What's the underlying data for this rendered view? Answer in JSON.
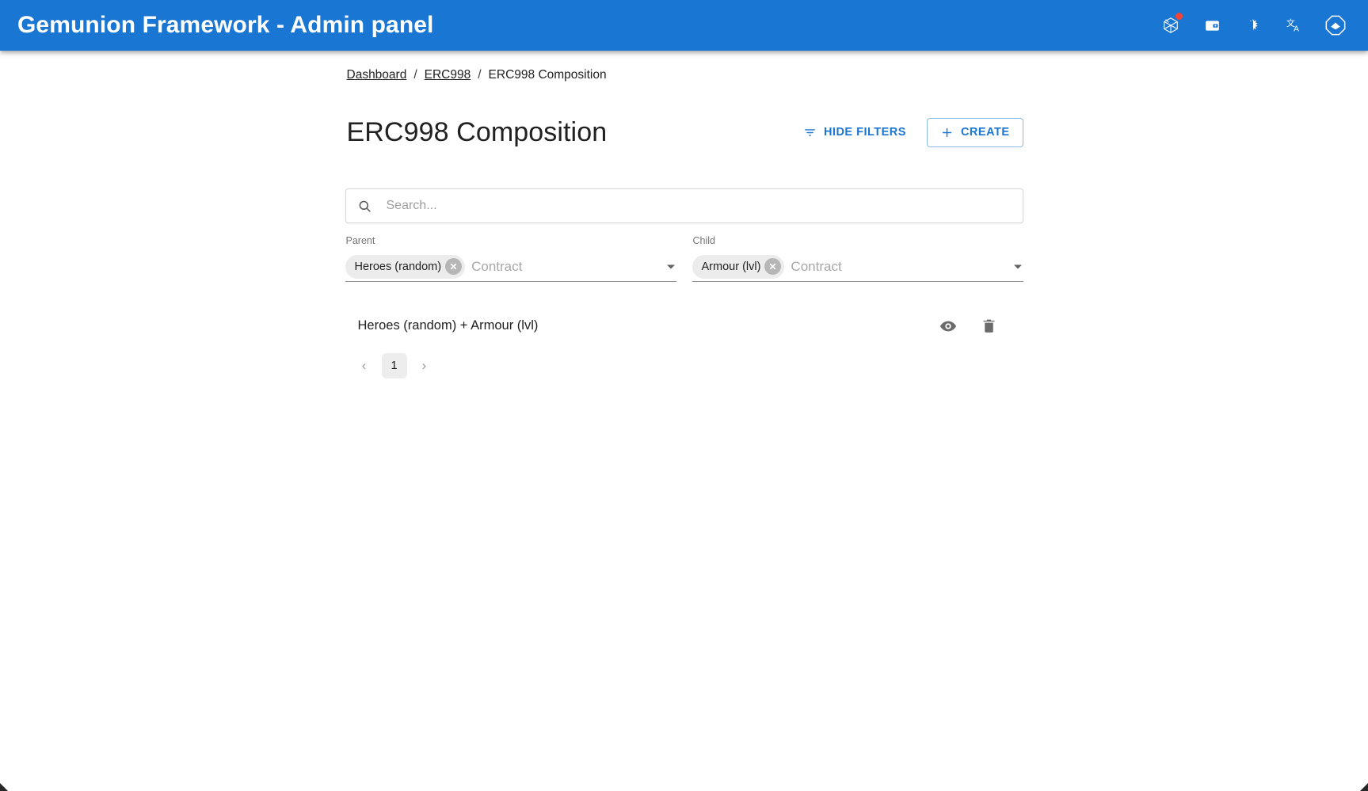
{
  "appbar": {
    "title": "Gemunion Framework - Admin panel",
    "background": "#1976d2",
    "actions": [
      {
        "name": "metamask-icon",
        "label": "Wallet connect"
      },
      {
        "name": "wallet-icon",
        "label": "Wallet"
      },
      {
        "name": "theme-toggle-icon",
        "label": "Toggle theme"
      },
      {
        "name": "language-icon",
        "label": "Language"
      },
      {
        "name": "user-avatar-icon",
        "label": "Profile"
      }
    ],
    "notification_dot_color": "#f44336"
  },
  "breadcrumbs": {
    "items": [
      {
        "label": "Dashboard",
        "link": true
      },
      {
        "label": "ERC998",
        "link": true
      },
      {
        "label": "ERC998 Composition",
        "link": false
      }
    ],
    "separator": "/"
  },
  "header": {
    "title": "ERC998 Composition",
    "hide_filters_label": "HIDE FILTERS",
    "create_label": "CREATE",
    "create_icon": "plus-icon",
    "filter_icon": "filter-list-icon",
    "accent_color": "#1976d2"
  },
  "search": {
    "placeholder": "Search...",
    "value": "",
    "icon": "search-icon"
  },
  "filters": {
    "parent": {
      "label": "Parent",
      "placeholder": "Contract",
      "chips": [
        {
          "label": "Heroes (random)",
          "delete_icon": "chip-close-icon"
        }
      ],
      "arrow_icon": "dropdown-arrow-icon"
    },
    "child": {
      "label": "Child",
      "placeholder": "Contract",
      "chips": [
        {
          "label": "Armour (lvl)",
          "delete_icon": "chip-close-icon"
        }
      ],
      "arrow_icon": "dropdown-arrow-icon"
    }
  },
  "list": {
    "items": [
      {
        "title": "Heroes (random) + Armour (lvl)",
        "actions": [
          {
            "name": "view-icon",
            "label": "View"
          },
          {
            "name": "delete-icon",
            "label": "Delete"
          }
        ]
      }
    ]
  },
  "pagination": {
    "prev_label": "‹",
    "next_label": "›",
    "pages": [
      "1"
    ],
    "current": "1"
  }
}
